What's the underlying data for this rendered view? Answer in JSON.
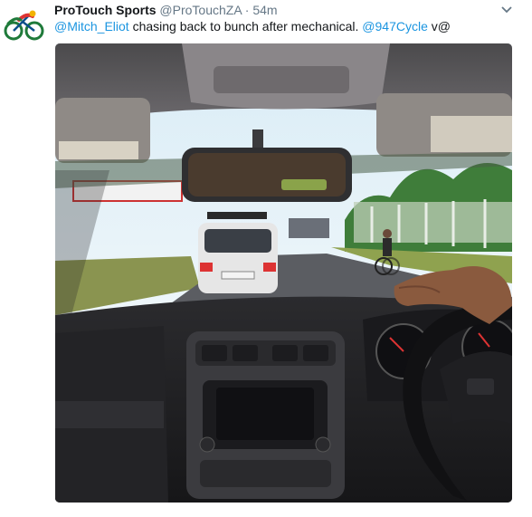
{
  "tweet": {
    "author_name": "ProTouch Sports",
    "author_handle": "@ProTouchZA",
    "separator": "·",
    "timestamp": "54m",
    "text_parts": {
      "mention1": "@Mitch_Eliot",
      "body": " chasing back to bunch after mechanical. ",
      "mention2": "@947Cycle",
      "tail": " v@"
    },
    "media": {
      "description_icon": "photo-dashcam"
    }
  },
  "colors": {
    "link": "#1b95e0",
    "name": "#14171a",
    "meta": "#657786"
  },
  "icons": {
    "avatar": "cyclist-logo-icon",
    "caret": "chevron-down-icon"
  }
}
